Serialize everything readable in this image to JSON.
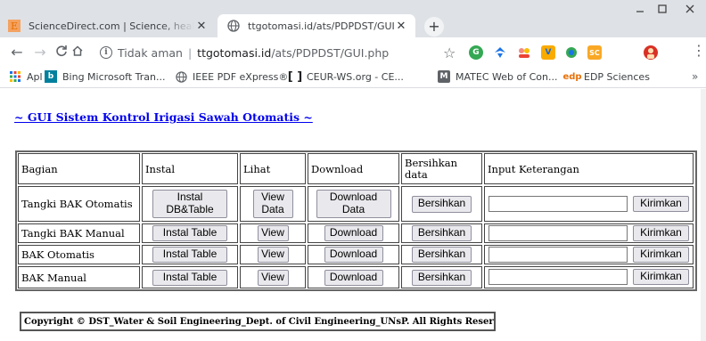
{
  "browser": {
    "tabs": [
      {
        "title": "ScienceDirect.com | Science, health and medical journals",
        "favicon": "sciencedirect-favicon",
        "active": false
      },
      {
        "title": "ttgotomasi.id/ats/PDPDST/GUI.php",
        "favicon": "globe-icon",
        "active": true
      }
    ],
    "new_tab_label": "+",
    "address": {
      "security_label": "Tidak aman",
      "host": "ttgotomasi.id",
      "path": "/ats/PDPDST/GUI.php"
    },
    "extension_icons": [
      "chrome-extension-icon",
      "blue-extension-icon",
      "people-extension-icon",
      "vocab-extension-icon",
      "color-extension-icon",
      "sc-extension-icon",
      "profile-avatar"
    ],
    "bookmarks": [
      {
        "label": "Apl",
        "icon": "apps-grid-icon"
      },
      {
        "label": "Bing Microsoft Tran...",
        "icon": "bing-icon"
      },
      {
        "label": "IEEE PDF eXpress®",
        "icon": "globe-icon"
      },
      {
        "label": "CEUR-WS.org - CE...",
        "icon": "bracket-icon"
      },
      {
        "label": "MATEC Web of Con...",
        "icon": "matec-icon"
      },
      {
        "label": "EDP Sciences",
        "icon": "edp-icon"
      }
    ],
    "bookmarks_more": "»"
  },
  "page": {
    "heading": "~ GUI Sistem Kontrol Irigasi Sawah Otomatis ~",
    "table": {
      "headers": [
        "Bagian",
        "Instal",
        "Lihat",
        "Download",
        "Bersihkan data",
        "Input Keterangan"
      ],
      "rows": [
        {
          "bagian": "Tangki BAK Otomatis",
          "instal": "Instal\nDB&Table",
          "lihat": "View\nData",
          "download": "Download\nData",
          "bersihkan": "Bersihkan",
          "input_value": "",
          "kirim": "Kirimkan"
        },
        {
          "bagian": "Tangki BAK Manual",
          "instal": "Instal Table",
          "lihat": "View",
          "download": "Download",
          "bersihkan": "Bersihkan",
          "input_value": "",
          "kirim": "Kirimkan"
        },
        {
          "bagian": "BAK Otomatis",
          "instal": "Instal Table",
          "lihat": "View",
          "download": "Download",
          "bersihkan": "Bersihkan",
          "input_value": "",
          "kirim": "Kirimkan"
        },
        {
          "bagian": "BAK Manual",
          "instal": "Instal Table",
          "lihat": "View",
          "download": "Download",
          "bersihkan": "Bersihkan",
          "input_value": "",
          "kirim": "Kirimkan"
        }
      ]
    },
    "footer": "Copyright © DST_Water & Soil Engineering_Dept. of Civil Engineering_UNsP. All Rights Reserved."
  }
}
